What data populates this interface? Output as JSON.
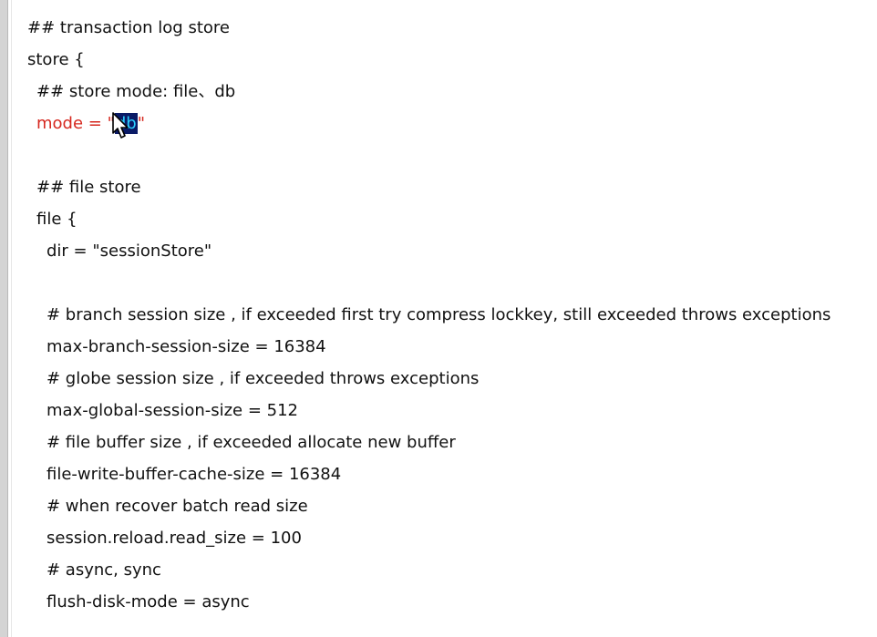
{
  "editor": {
    "lines": {
      "l1": "## transaction log store",
      "l2": "store {",
      "l3": "## store mode: file、db",
      "l4": {
        "prefix": "mode = \"",
        "selected": "db",
        "suffix": "\""
      },
      "l6": "## file store",
      "l7": "file {",
      "l8": "dir = \"sessionStore\"",
      "l10": "# branch session size , if exceeded first try compress lockkey, still exceeded throws exceptions",
      "l11": "max-branch-session-size = 16384",
      "l12": "# globe session size , if exceeded throws exceptions",
      "l13": "max-global-session-size = 512",
      "l14": "# file buffer size , if exceeded allocate new buffer",
      "l15": "file-write-buffer-cache-size = 16384",
      "l16": "# when recover batch read size",
      "l17": "session.reload.read_size = 100",
      "l18": "# async, sync",
      "l19": "flush-disk-mode = async"
    }
  },
  "colors": {
    "text": "#111111",
    "highlight_line": "#d6281f",
    "selection_bg": "#0a1a66",
    "selection_text": "#2bd0ff"
  },
  "icons": {
    "cursor": "mouse-pointer-icon"
  }
}
